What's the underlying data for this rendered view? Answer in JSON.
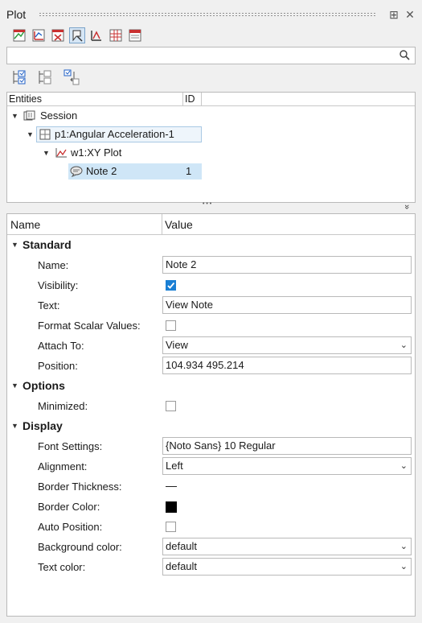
{
  "panel": {
    "title": "Plot",
    "close_glyph": "✕",
    "pin_glyph": "⊞"
  },
  "toolbar": {
    "icons": [
      "plot-page-icon",
      "xy-curve-icon",
      "delete-curve-icon",
      "note-tool-icon",
      "axis-tool-icon",
      "grid-tool-icon",
      "export-table-icon"
    ]
  },
  "search": {
    "value": "",
    "icon": "search-icon"
  },
  "tree": {
    "header": {
      "entities": "Entities",
      "id": "ID"
    },
    "rows": [
      {
        "label": "Session",
        "id": ""
      },
      {
        "label": "p1:Angular Acceleration-1",
        "id": ""
      },
      {
        "label": "w1:XY Plot",
        "id": ""
      },
      {
        "label": "Note 2",
        "id": "1"
      }
    ],
    "splitter_dots": "• • •",
    "expand_glyph": "»"
  },
  "props": {
    "header": {
      "name": "Name",
      "value": "Value"
    },
    "sections": {
      "standard": "Standard",
      "options": "Options",
      "display": "Display"
    },
    "labels": {
      "name": "Name:",
      "visibility": "Visibility:",
      "text": "Text:",
      "format_scalar": "Format Scalar Values:",
      "attach_to": "Attach To:",
      "position": "Position:",
      "minimized": "Minimized:",
      "font_settings": "Font Settings:",
      "alignment": "Alignment:",
      "border_thickness": "Border Thickness:",
      "border_color": "Border Color:",
      "auto_position": "Auto Position:",
      "background_color": "Background color:",
      "text_color": "Text color:"
    },
    "values": {
      "name": "Note 2",
      "visibility": true,
      "text": "View Note",
      "format_scalar": false,
      "attach_to": "View",
      "position": "104.934 495.214",
      "minimized": false,
      "font_settings": "{Noto Sans} 10 Regular",
      "alignment": "Left",
      "border_color": "#000000",
      "auto_position": false,
      "background_color": "default",
      "text_color": "default"
    }
  }
}
